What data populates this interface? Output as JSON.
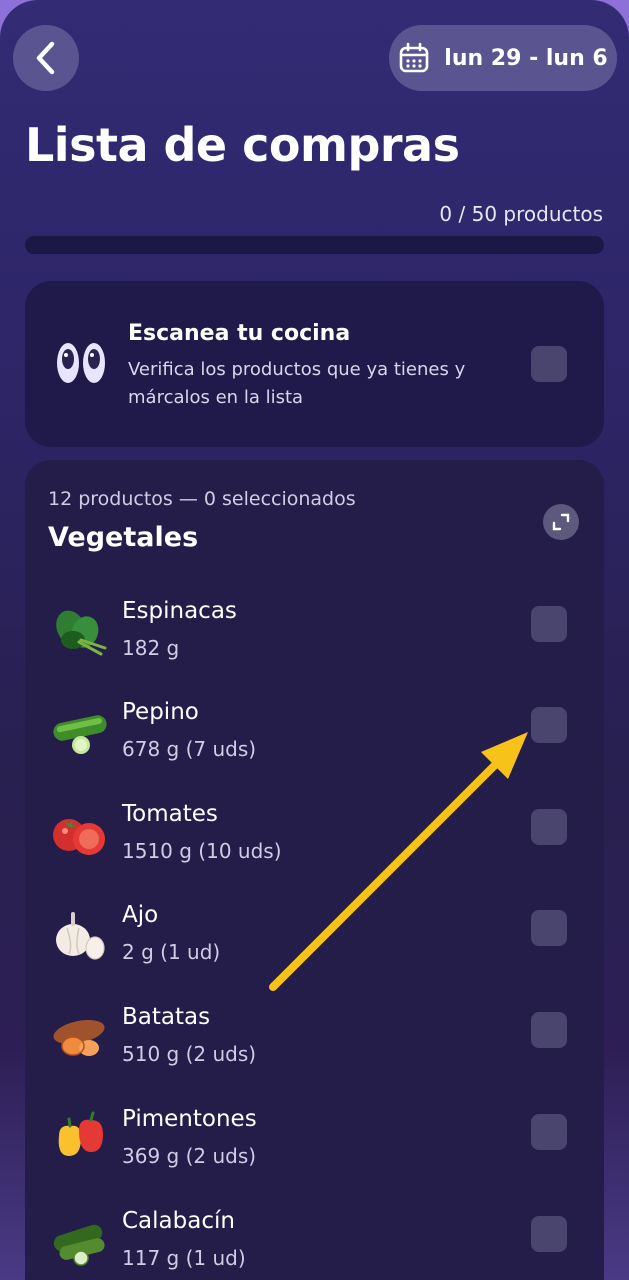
{
  "header": {
    "back_label": "back",
    "date_range": "lun 29 - lun 6"
  },
  "page": {
    "title": "Lista de compras",
    "count_label": "0 / 50  productos",
    "progress": 0
  },
  "scan": {
    "title": "Escanea tu cocina",
    "description": "Verifica los productos que ya tienes y márcalos en la lista"
  },
  "category": {
    "meta": "12 productos — 0 seleccionados",
    "title": "Vegetales",
    "items": [
      {
        "name": "Espinacas",
        "qty": "182 g",
        "icon": "spinach-icon"
      },
      {
        "name": "Pepino",
        "qty": "678 g  (7 uds)",
        "icon": "cucumber-icon"
      },
      {
        "name": "Tomates",
        "qty": "1510 g  (10 uds)",
        "icon": "tomato-icon"
      },
      {
        "name": "Ajo",
        "qty": "2 g  (1 ud)",
        "icon": "garlic-icon"
      },
      {
        "name": "Batatas",
        "qty": "510 g  (2 uds)",
        "icon": "sweet-potato-icon"
      },
      {
        "name": "Pimentones",
        "qty": "369 g  (2 uds)",
        "icon": "bell-pepper-icon"
      },
      {
        "name": "Calabacín",
        "qty": "117 g  (1 ud)",
        "icon": "zucchini-icon"
      }
    ]
  },
  "colors": {
    "accent_arrow": "#f7c21a",
    "checkbox": "#49456f",
    "card": "#241d4a"
  }
}
